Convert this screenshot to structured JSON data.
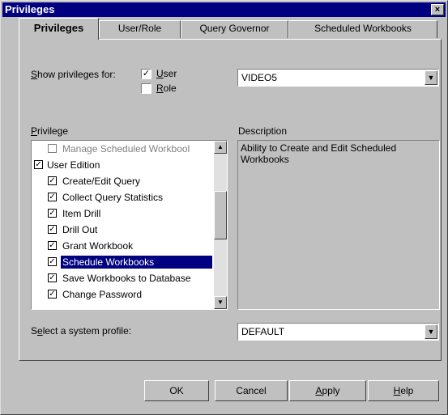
{
  "window": {
    "title": "Privileges"
  },
  "tabs": [
    {
      "label": "Privileges",
      "active": true
    },
    {
      "label": "User/Role"
    },
    {
      "label": "Query Governor"
    },
    {
      "label": "Scheduled Workbooks"
    }
  ],
  "show_privileges": {
    "label_prefix": "S",
    "label_rest": "how privileges for:",
    "user": {
      "u": "U",
      "rest": "ser",
      "checked": true
    },
    "role": {
      "u": "R",
      "rest": "ole",
      "checked": false
    }
  },
  "user_combo": {
    "value": "VIDEO5"
  },
  "privilege_list": {
    "label_u": "P",
    "label_rest": "rivilege",
    "items": [
      {
        "label": "Manage Scheduled Workbool",
        "checked": false,
        "disabled": true,
        "indent": 1
      },
      {
        "label": "User Edition",
        "checked": true,
        "indent": 0
      },
      {
        "label": "Create/Edit Query",
        "checked": true,
        "indent": 1
      },
      {
        "label": "Collect Query Statistics",
        "checked": true,
        "indent": 1
      },
      {
        "label": "Item Drill",
        "checked": true,
        "indent": 1
      },
      {
        "label": "Drill Out",
        "checked": true,
        "indent": 1
      },
      {
        "label": "Grant Workbook",
        "checked": true,
        "indent": 1
      },
      {
        "label": "Schedule Workbooks",
        "checked": true,
        "indent": 1,
        "selected": true
      },
      {
        "label": "Save Workbooks to Database",
        "checked": true,
        "indent": 1
      },
      {
        "label": "Change Password",
        "checked": true,
        "indent": 1
      }
    ]
  },
  "description": {
    "label": "Description",
    "text": "Ability to Create and Edit Scheduled Workbooks"
  },
  "system_profile": {
    "label_pre": "S",
    "label_u": "e",
    "label_rest": "lect a system profile:",
    "value": "DEFAULT"
  },
  "buttons": {
    "ok": "OK",
    "cancel": "Cancel",
    "apply_u": "A",
    "apply_rest": "pply",
    "help_u": "H",
    "help_rest": "elp"
  },
  "icons": {
    "close": "×",
    "dropdown": "▼",
    "scroll_up": "▲",
    "scroll_down": "▼",
    "check": "✓"
  }
}
